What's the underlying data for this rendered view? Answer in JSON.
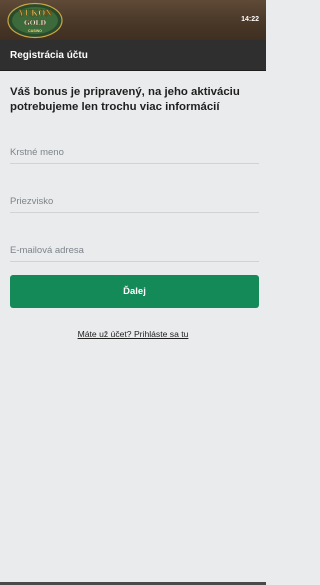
{
  "status_bar": {
    "time": "14:22"
  },
  "brand": {
    "logo_text_top": "YUKON",
    "logo_text_middle": "GOLD",
    "logo_text_bottom": "CASINO"
  },
  "header": {
    "title": "Registrácia účtu"
  },
  "intro": {
    "text": "Váš bonus je pripravený, na jeho aktiváciu potrebujeme len trochu viac informácií"
  },
  "form": {
    "first_name_placeholder": "Krstné meno",
    "first_name_value": "",
    "last_name_placeholder": "Priezvisko",
    "last_name_value": "",
    "email_placeholder": "E-mailová adresa",
    "email_value": "",
    "next_label": "Ďalej"
  },
  "login": {
    "link_text": "Máte už účet? Prihláste sa tu"
  },
  "colors": {
    "accent": "#138a57",
    "header_bg": "#2f2f2f",
    "page_bg": "#e9ebed",
    "top_bar": "#4a3828"
  }
}
